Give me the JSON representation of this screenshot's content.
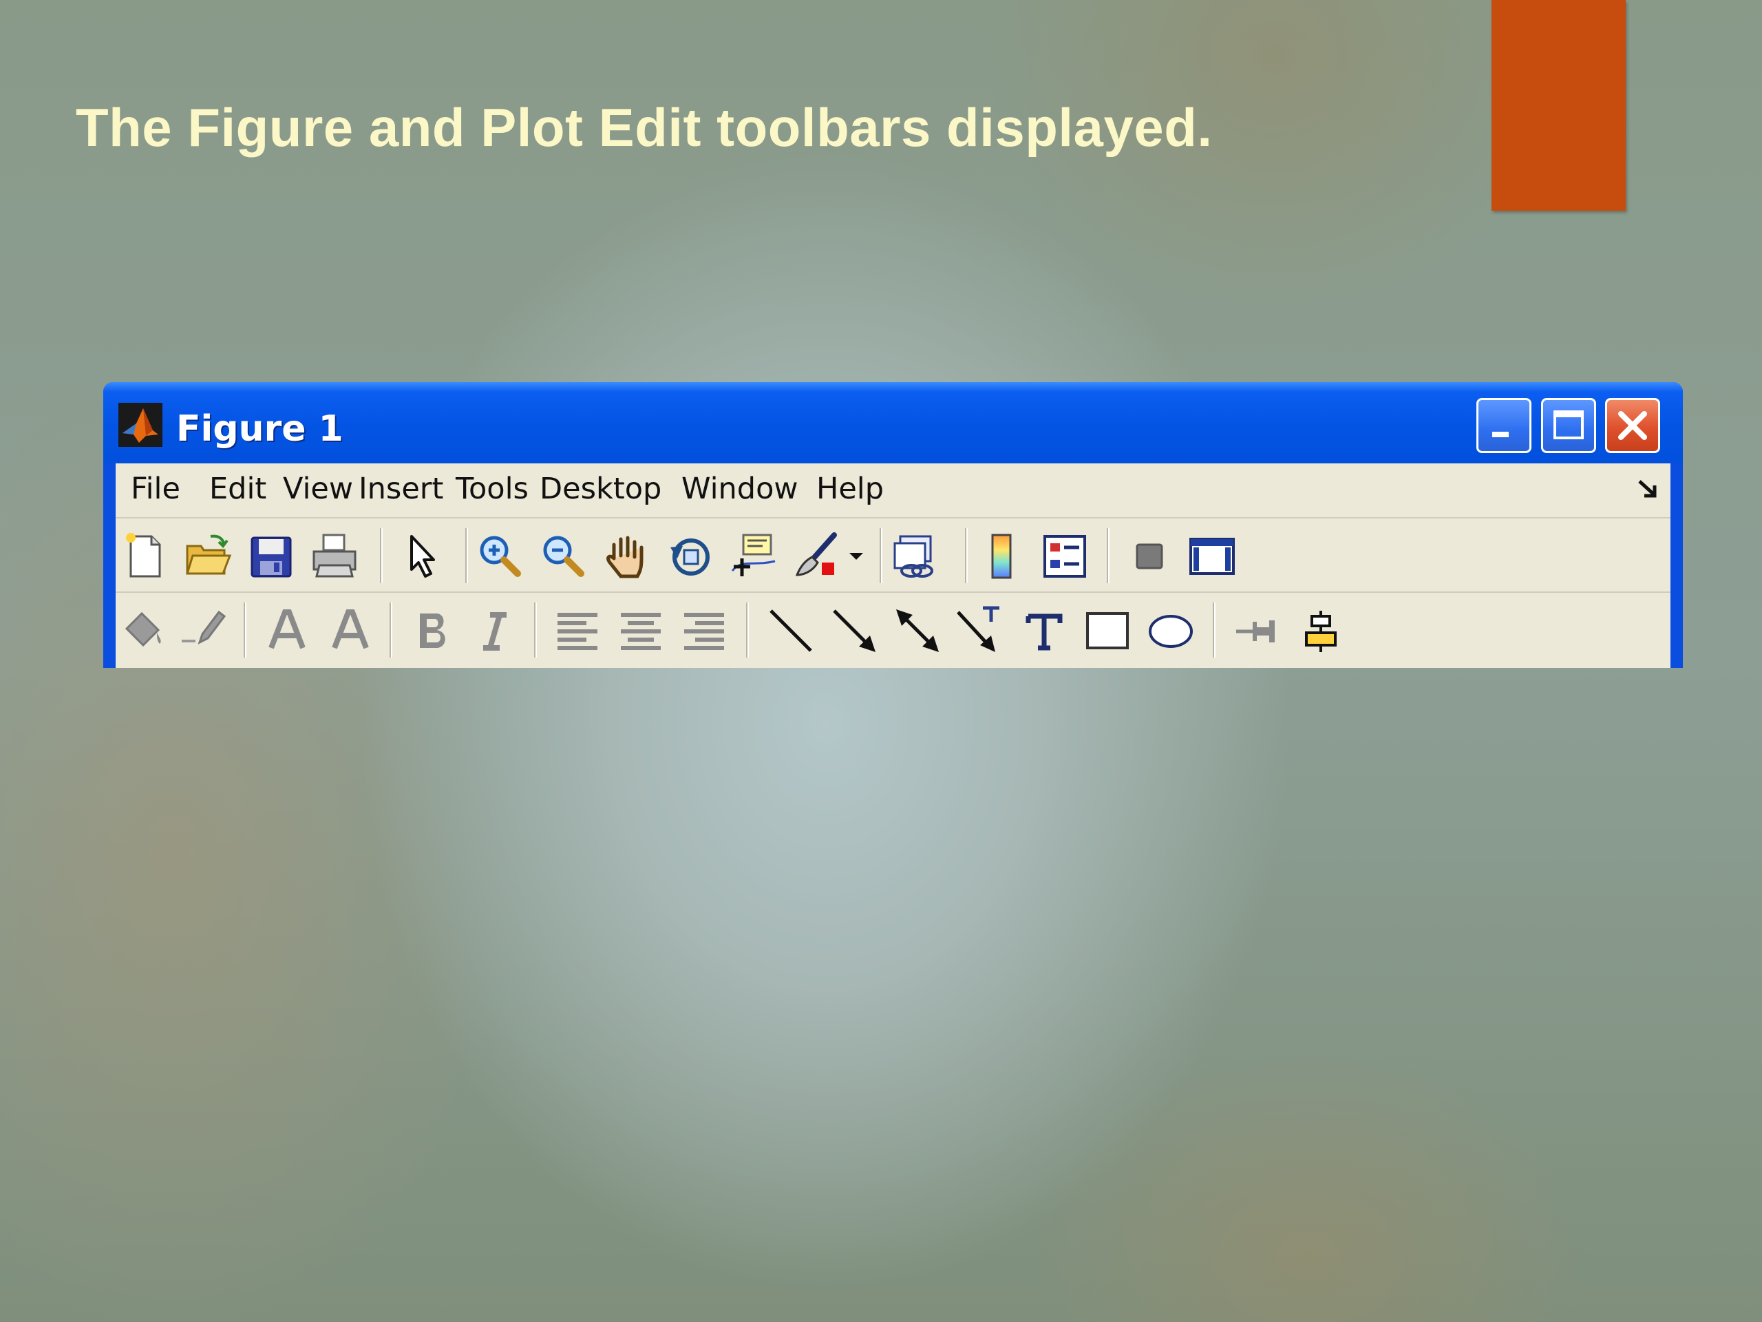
{
  "slide": {
    "title": "The Figure and Plot Edit toolbars displayed."
  },
  "colors": {
    "accent": "#c64d0d",
    "title_text": "#fbf7c6",
    "titlebar": "#0454e4",
    "toolbar_bg": "#ece9d8"
  },
  "window": {
    "title": "Figure 1",
    "app_icon": "matlab-logo-icon",
    "controls": [
      "minimize-icon",
      "maximize-icon",
      "close-icon"
    ]
  },
  "menu": {
    "items": [
      "File",
      "Edit",
      "View",
      "Insert",
      "Tools",
      "Desktop",
      "Window",
      "Help"
    ],
    "dock_icon": "dock-arrow-icon"
  },
  "figure_toolbar": {
    "buttons": [
      "new-figure-icon",
      "open-file-icon",
      "save-icon",
      "print-icon",
      "edit-plot-arrow-icon",
      "zoom-in-icon",
      "zoom-out-icon",
      "pan-hand-icon",
      "rotate-3d-icon",
      "data-cursor-icon",
      "brush-icon",
      "brush-dropdown-icon",
      "link-plot-icon",
      "colorbar-icon",
      "legend-icon",
      "hide-plot-tools-icon",
      "show-plot-tools-icon"
    ]
  },
  "plot_edit_toolbar": {
    "buttons": [
      "face-color-icon",
      "edge-color-icon",
      "text-color-icon",
      "font-icon",
      "bold-icon",
      "italic-icon",
      "align-left-icon",
      "align-center-icon",
      "align-right-icon",
      "line-icon",
      "arrow-icon",
      "double-arrow-icon",
      "text-arrow-icon",
      "text-box-icon",
      "rectangle-icon",
      "ellipse-icon",
      "pin-icon",
      "align-distribute-icon"
    ]
  }
}
